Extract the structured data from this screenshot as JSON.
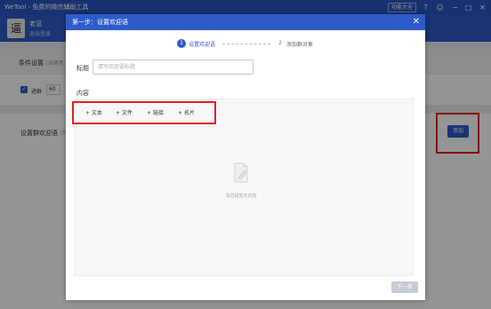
{
  "app": {
    "title": "WeTool - 免费的微信辅助工具",
    "function_button": "功能大全",
    "avatar_glyph": "逼",
    "nickname": "老湿",
    "logout": "退出登录",
    "accent": "#2d5bc9",
    "highlight": "#e02020"
  },
  "conditions": {
    "title": "条件设置",
    "hint": "(当两者",
    "checkbox_label": "进群",
    "checkbox_checked": true,
    "count": "60"
  },
  "welcome": {
    "title": "设置群欢迎语",
    "hint": "(可",
    "add_button": "添加"
  },
  "modal": {
    "title": "第一步：设置欢迎语",
    "steps": [
      {
        "num": "1",
        "label": "设置欢迎语",
        "active": true
      },
      {
        "num": "2",
        "label": "添加群对象",
        "active": false
      }
    ],
    "title_label": "标题",
    "title_placeholder": "请写欢迎语标题",
    "title_value": "",
    "content_label": "内容",
    "toolbar": [
      "+ 文本",
      "+ 文件",
      "+ 链接",
      "+ 名片"
    ],
    "empty_text": "消息组暂无内容",
    "next_button": "下一步"
  }
}
